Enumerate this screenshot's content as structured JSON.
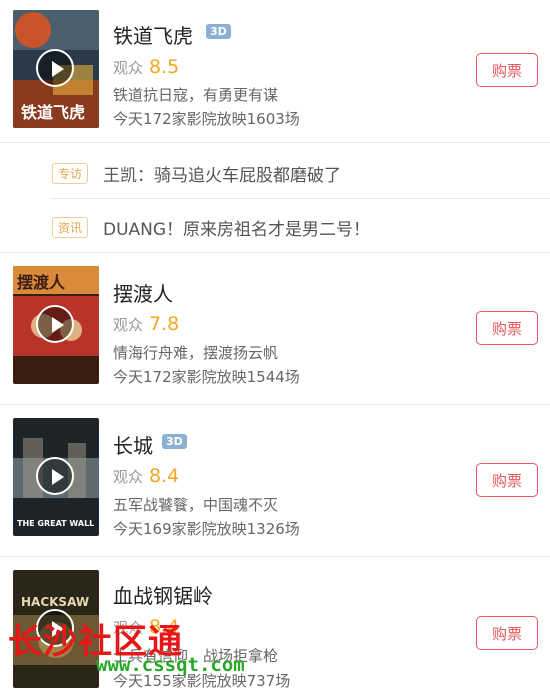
{
  "movies": [
    {
      "title": "铁道飞虎",
      "badge": "3D",
      "score_label": "观众",
      "score": "8.5",
      "desc": "铁道抗日寇，有勇更有谋",
      "cinemas": "今天172家影院放映1603场",
      "buy": "购票",
      "poster_colors": [
        "#2b3a4a",
        "#c9542a",
        "#e8b13b"
      ]
    },
    {
      "title": "摆渡人",
      "badge": "",
      "score_label": "观众",
      "score": "7.8",
      "desc": "情海行舟难，摆渡扬云帆",
      "cinemas": "今天172家影院放映1544场",
      "buy": "购票",
      "poster_colors": [
        "#3a1d12",
        "#b8332a",
        "#d98a3a"
      ]
    },
    {
      "title": "长城",
      "badge": "3D",
      "score_label": "观众",
      "score": "8.4",
      "desc": "五军战饕餮，中国魂不灭",
      "cinemas": "今天169家影院放映1326场",
      "buy": "购票",
      "poster_colors": [
        "#1f2428",
        "#5d6a70",
        "#a59a88"
      ]
    },
    {
      "title": "血战钢锯岭",
      "badge": "",
      "score_label": "观众",
      "score": "8.4",
      "desc": "士兵有信仰，战场拒拿枪",
      "cinemas": "今天155家影院放映737场",
      "buy": "购票",
      "poster_colors": [
        "#2a2618",
        "#6b5a34",
        "#b39550"
      ]
    }
  ],
  "news": [
    {
      "tag": "专访",
      "text": "王凯：骑马追火车屁股都磨破了"
    },
    {
      "tag": "资讯",
      "text": "DUANG！原来房祖名才是男二号！"
    }
  ],
  "poster_texts": {
    "p1": "铁道飞虎",
    "p2": "摆渡人",
    "p3": "THE GREAT WALL",
    "p4": "HACKSAW"
  },
  "watermark": {
    "title": "长沙社区通",
    "url": "www.cssqt.com"
  },
  "colors": {
    "accent": "#e8575b",
    "score": "#f5a623",
    "tag": "#e0a84a",
    "badge3d": "#8cb0d4"
  }
}
